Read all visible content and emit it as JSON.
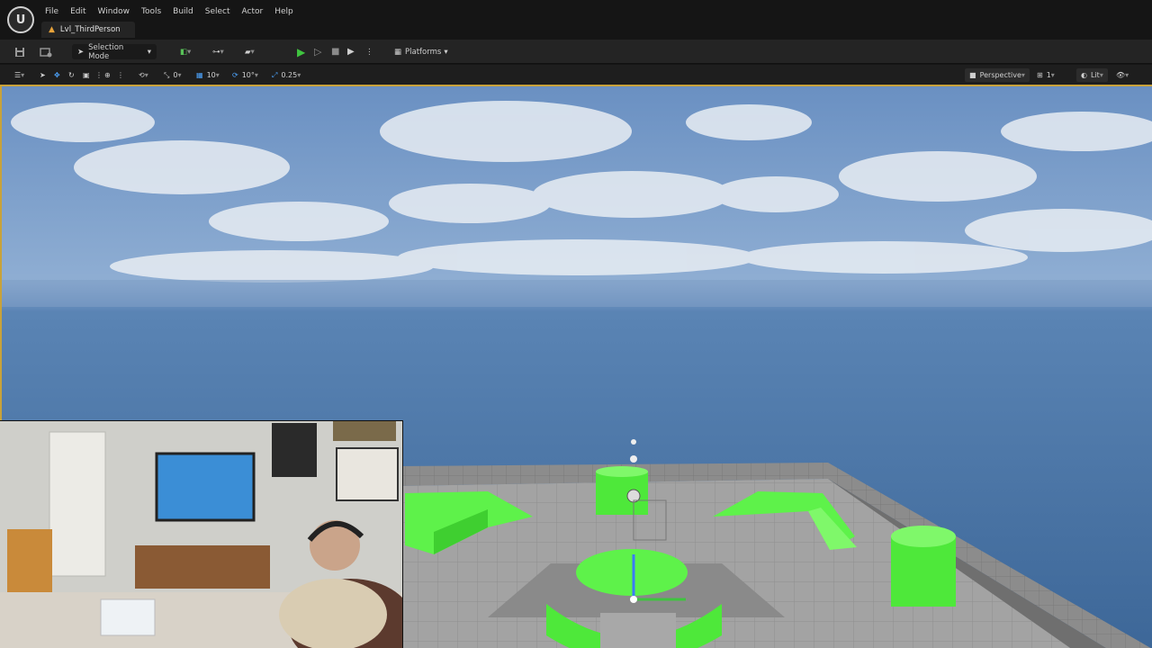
{
  "app": {
    "logo_text": "U",
    "menus": [
      "File",
      "Edit",
      "Window",
      "Tools",
      "Build",
      "Select",
      "Actor",
      "Help"
    ],
    "level_tab": "Lvl_ThirdPerson"
  },
  "toolbar": {
    "selection_mode": "Selection Mode",
    "platforms": "Platforms"
  },
  "viewport_toolbar": {
    "translate_snap": "0",
    "grid_snap": "10",
    "rotate_snap": "10°",
    "scale_snap": "0.25",
    "view_mode_camera": "Perspective",
    "layout_count": "1",
    "lighting_mode": "Lit"
  },
  "colors": {
    "accent": "#c8a23a",
    "play": "#3fc43f",
    "platform_green": "#5ef24a",
    "sky_top": "#5f86b8",
    "ground_gray": "#9a9a9a"
  },
  "icons": [
    "ue-logo",
    "save-icon",
    "content-browser-icon",
    "play-icon",
    "pause-icon",
    "stop-icon",
    "eject-icon",
    "more-icon",
    "select-icon",
    "move-icon",
    "rotate-icon",
    "scale-icon",
    "world-icon",
    "camera-icon",
    "eye-icon"
  ]
}
